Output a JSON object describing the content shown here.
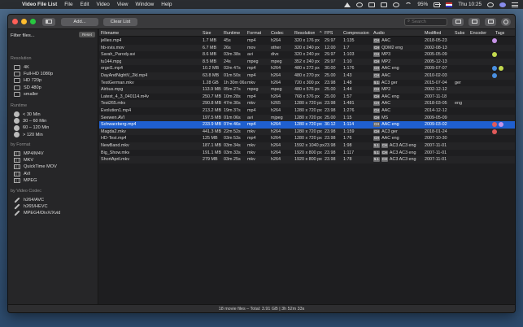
{
  "menubar": {
    "app_name": "Video File List",
    "menus": [
      "File",
      "Edit",
      "Video",
      "View",
      "Window",
      "Help"
    ],
    "battery": "95%",
    "clock": "Thu 10:25"
  },
  "toolbar": {
    "add_label": "Add...",
    "clear_label": "Clear List",
    "search_placeholder": "Search"
  },
  "sidebar": {
    "header": "Filter files...",
    "reset_label": "Reset",
    "sections": [
      {
        "title": "Resolution",
        "icon": "screen-icon",
        "items": [
          "4K",
          "Full-HD 1080p",
          "HD 720p",
          "SD 480p",
          "smaller"
        ]
      },
      {
        "title": "Runtime",
        "icon": "clock-icon",
        "items": [
          "< 30 Min",
          "30 – 60 Min",
          "60 – 120 Min",
          "> 120 Min"
        ]
      },
      {
        "title": "by Format",
        "icon": "film-icon",
        "items": [
          "MP4/M4V",
          "MKV",
          "QuickTime MOV",
          "AVI",
          "MPEG"
        ]
      },
      {
        "title": "by Video Codec",
        "icon": "wrench-icon",
        "items": [
          "h264/AVC",
          "h265/HEVC",
          "MPEG4/DivX/Xvid"
        ]
      }
    ]
  },
  "table": {
    "columns": [
      "Filename",
      "Size",
      "Runtime",
      "Format",
      "Codec",
      "Resolution",
      "FPS",
      "Compression",
      "Audio",
      "Modified",
      "Subs",
      "Encoder",
      "Tags"
    ],
    "sort_indicator": "^",
    "rows": [
      {
        "filename": "jellies.mp4",
        "size": "1.7 MB",
        "runtime": "45s",
        "format": "mp4",
        "codec": "h264",
        "resolution": "320 x 176 px",
        "fps": "29.97",
        "compression": "1:135",
        "audio_badges": [
          "CH"
        ],
        "audio": "AAC",
        "modified": "2018-05-23",
        "subs": "",
        "encoder": "",
        "tags": [
          "#c693e8"
        ]
      },
      {
        "filename": "hb-xvis.mov",
        "size": "6.7 MB",
        "runtime": "26s",
        "format": "mov",
        "codec": "other",
        "resolution": "320 x 240 px",
        "fps": "12.00",
        "compression": "1:7",
        "audio_badges": [
          "CH"
        ],
        "audio": "QDM2 eng",
        "modified": "2002-08-13",
        "subs": "",
        "encoder": "",
        "tags": []
      },
      {
        "filename": "Sarah_Parody.avi",
        "size": "8.6 MB",
        "runtime": "03m 38s",
        "format": "avi",
        "codec": "divx",
        "resolution": "320 x 240 px",
        "fps": "29.97",
        "compression": "1:103",
        "audio_badges": [
          "CH"
        ],
        "audio": "MP3",
        "modified": "2005-05-09",
        "subs": "",
        "encoder": "",
        "tags": [
          "#c3d94e"
        ]
      },
      {
        "filename": "tu144.mpg",
        "size": "8.5 MB",
        "runtime": "24s",
        "format": "mpeg",
        "codec": "mpeg",
        "resolution": "352 x 240 px",
        "fps": "29.97",
        "compression": "1:10",
        "audio_badges": [
          "CH"
        ],
        "audio": "MP2",
        "modified": "2005-12-13",
        "subs": "",
        "encoder": "",
        "tags": []
      },
      {
        "filename": "orgel1.mp4",
        "size": "10.2 MB",
        "runtime": "02m 47s",
        "format": "mp4",
        "codec": "h264",
        "resolution": "480 x 272 px",
        "fps": "30.00",
        "compression": "1:176",
        "audio_badges": [
          "CH"
        ],
        "audio": "AAC eng",
        "modified": "2009-07-07",
        "subs": "",
        "encoder": "",
        "tags": [
          "#4a90e2",
          "#c3d94e"
        ]
      },
      {
        "filename": "DayAndNightV_2kl.mp4",
        "size": "63.8 MB",
        "runtime": "01m 50s",
        "format": "mp4",
        "codec": "h264",
        "resolution": "480 x 270 px",
        "fps": "25.00",
        "compression": "1:43",
        "audio_badges": [
          "CH"
        ],
        "audio": "AAC",
        "modified": "2010-02-03",
        "subs": "",
        "encoder": "",
        "tags": [
          "#4a90e2"
        ]
      },
      {
        "filename": "TestGerman.mkv",
        "size": "1.28 GB",
        "runtime": "1h 30m 06s",
        "format": "mkv",
        "codec": "h264",
        "resolution": "720 x 300 px",
        "fps": "23.98",
        "compression": "1:48",
        "audio_badges": [
          "5.1"
        ],
        "audio": "AC3 ger",
        "modified": "2015-07-04",
        "subs": "ger",
        "encoder": "",
        "tags": []
      },
      {
        "filename": "Airbus.mpg",
        "size": "113.9 MB",
        "runtime": "05m 27s",
        "format": "mpeg",
        "codec": "mpeg",
        "resolution": "480 x 576 px",
        "fps": "25.00",
        "compression": "1:44",
        "audio_badges": [
          "CH"
        ],
        "audio": "MP2",
        "modified": "2002-12-12",
        "subs": "",
        "encoder": "",
        "tags": []
      },
      {
        "filename": "Latest_4_3_040114.m4v",
        "size": "250.7 MB",
        "runtime": "10m 28s",
        "format": "mp4",
        "codec": "h264",
        "resolution": "768 x 576 px",
        "fps": "25.00",
        "compression": "1:57",
        "audio_badges": [
          "CH"
        ],
        "audio": "AAC eng",
        "modified": "2007-11-18",
        "subs": "",
        "encoder": "",
        "tags": []
      },
      {
        "filename": "Test265.mkv",
        "size": "290.8 MB",
        "runtime": "47m 30s",
        "format": "mkv",
        "codec": "h265",
        "resolution": "1280 x 720 px",
        "fps": "23.98",
        "compression": "1:481",
        "audio_badges": [
          "CH"
        ],
        "audio": "AAC",
        "modified": "2018-03-05",
        "subs": "eng",
        "encoder": "",
        "tags": []
      },
      {
        "filename": "Evolution1.mp4",
        "size": "213.2 MB",
        "runtime": "19m 37s",
        "format": "mp4",
        "codec": "h264",
        "resolution": "1280 x 720 px",
        "fps": "23.98",
        "compression": "1:276",
        "audio_badges": [
          "CH"
        ],
        "audio": "AAC",
        "modified": "2014-12-12",
        "subs": "",
        "encoder": "",
        "tags": []
      },
      {
        "filename": "Seewen.AVI",
        "size": "197.5 MB",
        "runtime": "01m 06s",
        "format": "avi",
        "codec": "mjpeg",
        "resolution": "1280 x 720 px",
        "fps": "25.00",
        "compression": "1:15",
        "audio_badges": [
          "CH"
        ],
        "audio": "MS",
        "modified": "2009-05-09",
        "subs": "",
        "encoder": "",
        "tags": []
      },
      {
        "filename": "Schwarzberg.mp4",
        "size": "233.9 MB",
        "runtime": "07m 46s",
        "format": "mp4",
        "codec": "h264",
        "resolution": "1280 x 720 px",
        "fps": "30.12",
        "compression": "1:114",
        "audio_badges": [
          "CH"
        ],
        "audio": "AAC eng",
        "modified": "2009-03-02",
        "subs": "",
        "encoder": "",
        "tags": [
          "#e05a5a",
          "#c693e8"
        ],
        "selected": true
      },
      {
        "filename": "Magda2.mkv",
        "size": "441.3 MB",
        "runtime": "22m 52s",
        "format": "mkv",
        "codec": "h264",
        "resolution": "1280 x 720 px",
        "fps": "23.98",
        "compression": "1:159",
        "audio_badges": [
          "CH"
        ],
        "audio": "AC3 ger",
        "modified": "2018-01-24",
        "subs": "",
        "encoder": "",
        "tags": [
          "#e05a5a"
        ]
      },
      {
        "filename": "HD-Test.mp4",
        "size": "125 MB",
        "runtime": "03m 53s",
        "format": "mp4",
        "codec": "h264",
        "resolution": "1280 x 720 px",
        "fps": "23.98",
        "compression": "1:76",
        "audio_badges": [
          "CH"
        ],
        "audio": "AAC eng",
        "modified": "2007-10-30",
        "subs": "",
        "encoder": "",
        "tags": []
      },
      {
        "filename": "NewBand.mkv",
        "size": "187.1 MB",
        "runtime": "03m 34s",
        "format": "mkv",
        "codec": "h264",
        "resolution": "1592 x 1040 px",
        "fps": "23.98",
        "compression": "1:98",
        "audio_badges": [
          "5.1",
          "CH"
        ],
        "audio": "AC3 AC3 eng",
        "modified": "2007-11-01",
        "subs": "",
        "encoder": "",
        "tags": []
      },
      {
        "filename": "Big_Show.mkv",
        "size": "191.1 MB",
        "runtime": "03m 33s",
        "format": "mkv",
        "codec": "h264",
        "resolution": "1920 x 800 px",
        "fps": "23.98",
        "compression": "1:117",
        "audio_badges": [
          "5.1",
          "CH"
        ],
        "audio": "AC3 AC3 eng",
        "modified": "2007-11-01",
        "subs": "",
        "encoder": "",
        "tags": []
      },
      {
        "filename": "ShortApril.mkv",
        "size": "279 MB",
        "runtime": "03m 25s",
        "format": "mkv",
        "codec": "h264",
        "resolution": "1920 x 800 px",
        "fps": "23.98",
        "compression": "1:78",
        "audio_badges": [
          "5.1",
          "CH"
        ],
        "audio": "AC3 AC3 eng",
        "modified": "2007-11-01",
        "subs": "",
        "encoder": "",
        "tags": []
      }
    ]
  },
  "statusbar": {
    "text": "18 movie files – Total: 3.91 GB | 3h 52m 33s"
  },
  "colors": {
    "selection": "#1f5fcf",
    "window_bg": "#1f1f21",
    "accent": "#4a90e2"
  }
}
